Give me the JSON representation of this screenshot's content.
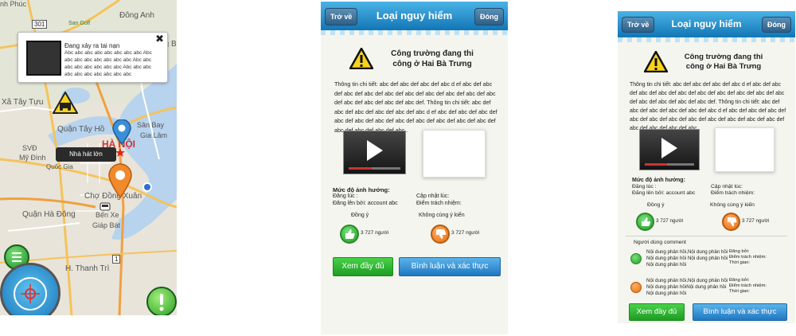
{
  "map": {
    "labels": {
      "dong_anh": "Đông Anh",
      "san_golf": "San Golf",
      "long_bien_top": "Long Bi",
      "vinh_phuc": "nh Phúc",
      "xa_tay_tuu": "Xã Tây Tựu",
      "quan_tay_ho": "Quận Tây Hồ",
      "san_bay": "Sân Bay",
      "gia_lam": "Gia Lâm",
      "ha_noi": "HÀ NỘI",
      "svd": "SVĐ",
      "my_dinh": "Mỹ Đình",
      "quoc_gia": "Quốc Gia",
      "cho_dong_xuan": "Chợ Đồng Xuân",
      "quan_ha_dong": "Quận Hà Đông",
      "ben_xe": "Bến Xe",
      "giap_bat": "Giáp Bát",
      "thanh_tri": "H. Thanh Trì",
      "road_301": "301",
      "road_3": "3",
      "road_1": "1"
    },
    "popup": {
      "title": "Đang xảy ra tai nạn",
      "desc": "Abc abc abc abc abc abc abc abc Abc abc abc abc abc abc abc abc Abc abc abc abc abc abc abc abc Abc abc abc abc abc abc abc abc abc abc",
      "close": "✖"
    },
    "tooltip": "Nhà hát lớn",
    "colors": {
      "pin": "#f08a2a",
      "water": "#b7d3ee",
      "road": "#f4c35b"
    }
  },
  "screen2": {
    "back_label": "Trở về",
    "title": "Loại nguy hiểm",
    "close_label": "Đóng",
    "warn_line1": "Công trường đang thi",
    "warn_line2": "công ở Hai Bà Trưng",
    "body": "Thông tin chi tiết: abc def abc def abc def abc d ef abc def abc def abc def abc def abc def abc def abc def abc def abc def abc def abc def abc def abc def abc def. Thông tin chi tiết: abc def abc def abc def abc def abc def abc d ef abc def abc def abc def abc def abc def abc def abc def abc def abc def abc def abc def abc def abc def abc def abc .",
    "impact_label": "Mức độ ảnh hưởng:",
    "time_label": "Đăng lúc :",
    "by_label": "Đăng lên bởi: account abc",
    "update_label": "Cập nhật lúc:",
    "resp_label": "Điểm trách nhiệm:",
    "agree_label": "Đồng ý",
    "disagree_label": "Không cùng ý kiến",
    "agree_count": "3 727 người",
    "disagree_count": "3 727 người",
    "view_full": "Xem đầy đủ",
    "comment_verify": "Bình luận và xác thực"
  },
  "screen3": {
    "back_label": "Trở về",
    "title": "Loại nguy hiểm",
    "close_label": "Đóng",
    "warn_line1": "Công trường đang thi",
    "warn_line2": "công ở Hai Bà Trưng",
    "body": "Thông tin chi tiết: abc def abc def abc def abc d ef abc def abc def abc def abc def abc def abc def abc def abc def abc def abc def abc def abc def abc def abc def. Thông tin chi tiết: abc def abc def abc def abc def abc def abc d ef abc def abc def abc def abc def abc def abc def abc def abc def abc def abc def abc def abc def abc def abc def abc .",
    "impact_label": "Mức độ ảnh hưởng:",
    "time_label": "Đăng lúc :",
    "by_label": "Đăng lên bởi: account abc",
    "update_label": "Cập nhật lúc:",
    "resp_label": "Điểm trách nhiệm:",
    "agree_label": "Đồng ý",
    "disagree_label": "Không cùng ý kiến",
    "agree_count": "3 727 người",
    "disagree_count": "3 727 người",
    "comments_header": "Người dùng comment",
    "comments": [
      {
        "type": "agree",
        "line1": "Nội dung phản hồi,Nội dung phản hồi",
        "line2": "Nội dung phản hồi Nội dung phản hồi",
        "line3": "Nội dung phản hồi",
        "posted_by": "Đăng bởi:",
        "resp": "Điểm trách nhiệm:",
        "time": "Thời gian:"
      },
      {
        "type": "disagree",
        "line1": "Nội dung phản hồi,Nội dung phản hồi",
        "line2": "Nội dung phản hồiNội dung phản hồi",
        "line3": "Nội dung phản hồi",
        "posted_by": "Đăng bởi:",
        "resp": "Điểm trách nhiệm:",
        "time": "Thời gian:"
      }
    ],
    "view_full": "Xem đầy đủ",
    "comment_verify": "Bình luận và xác thực"
  }
}
